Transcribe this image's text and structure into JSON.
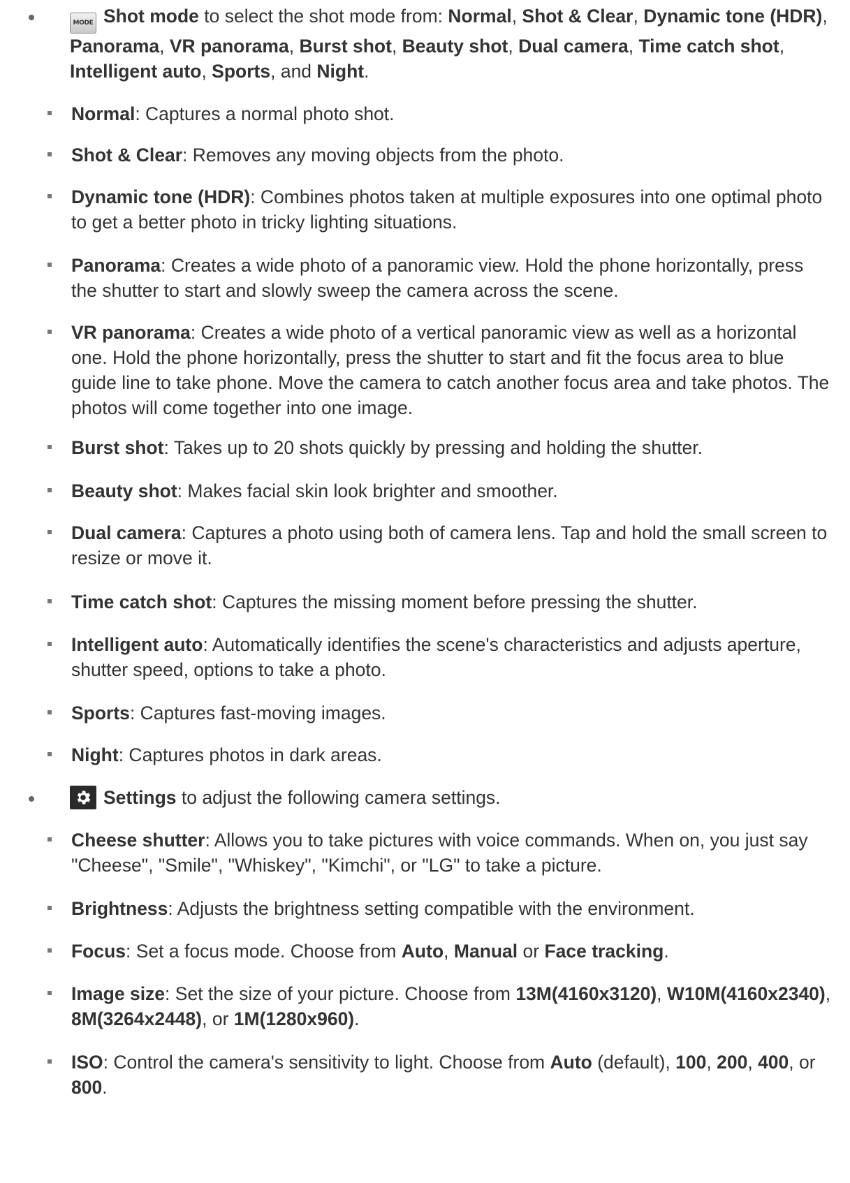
{
  "shot_mode": {
    "icon": "mode-icon",
    "icon_text": "MODE",
    "intro": [
      {
        "t": "Shot mode",
        "b": true
      },
      {
        "t": " to select the shot mode from: "
      },
      {
        "t": "Normal",
        "b": true
      },
      {
        "t": ", "
      },
      {
        "t": "Shot & Clear",
        "b": true
      },
      {
        "t": ", "
      },
      {
        "t": "Dynamic tone (HDR)",
        "b": true
      },
      {
        "t": ", "
      },
      {
        "t": "Panorama",
        "b": true
      },
      {
        "t": ", "
      },
      {
        "t": "VR panorama",
        "b": true
      },
      {
        "t": ", "
      },
      {
        "t": "Burst shot",
        "b": true
      },
      {
        "t": ", "
      },
      {
        "t": "Beauty shot",
        "b": true
      },
      {
        "t": ", "
      },
      {
        "t": "Dual camera",
        "b": true
      },
      {
        "t": ", "
      },
      {
        "t": "Time catch shot",
        "b": true
      },
      {
        "t": ", "
      },
      {
        "t": "Intelligent auto",
        "b": true
      },
      {
        "t": ", "
      },
      {
        "t": "Sports",
        "b": true
      },
      {
        "t": ", and "
      },
      {
        "t": "Night",
        "b": true
      },
      {
        "t": "."
      }
    ],
    "items": [
      [
        {
          "t": "Normal",
          "b": true
        },
        {
          "t": ": Captures a normal photo shot."
        }
      ],
      [
        {
          "t": "Shot & Clear",
          "b": true
        },
        {
          "t": ": Removes any moving objects from the photo."
        }
      ],
      [
        {
          "t": "Dynamic tone (HDR)",
          "b": true
        },
        {
          "t": ": Combines photos taken at multiple exposures into one optimal photo to get a better photo in tricky lighting situations."
        }
      ],
      [
        {
          "t": "Panorama",
          "b": true
        },
        {
          "t": ": Creates a wide photo of a panoramic view. Hold the phone horizontally, press the shutter to start and slowly sweep the camera across the scene."
        }
      ],
      [
        {
          "t": "VR panorama",
          "b": true
        },
        {
          "t": ": Creates a wide photo of a vertical panoramic view as well as a horizontal one. Hold the phone horizontally, press the shutter to start and fit the focus area to blue guide line to take phone. Move the camera to catch another focus area and take photos. The photos will come together into one image."
        }
      ],
      [
        {
          "t": "Burst shot",
          "b": true
        },
        {
          "t": ": Takes up to 20 shots quickly by pressing and holding the shutter."
        }
      ],
      [
        {
          "t": "Beauty shot",
          "b": true
        },
        {
          "t": ": Makes facial skin look brighter and smoother."
        }
      ],
      [
        {
          "t": "Dual camera",
          "b": true
        },
        {
          "t": ": Captures a photo using both of camera lens. Tap and hold the small screen to resize or move it."
        }
      ],
      [
        {
          "t": "Time catch shot",
          "b": true
        },
        {
          "t": ": Captures the missing moment before pressing the shutter."
        }
      ],
      [
        {
          "t": "Intelligent auto",
          "b": true
        },
        {
          "t": ": Automatically identifies the scene's characteristics and adjusts aperture, shutter speed, options to take a photo."
        }
      ],
      [
        {
          "t": "Sports",
          "b": true
        },
        {
          "t": ": Captures fast-moving images."
        }
      ],
      [
        {
          "t": "Night",
          "b": true
        },
        {
          "t": ": Captures photos in dark areas."
        }
      ]
    ]
  },
  "settings": {
    "icon": "gear-icon",
    "intro": [
      {
        "t": "Settings",
        "b": true
      },
      {
        "t": " to adjust the following camera settings."
      }
    ],
    "items": [
      [
        {
          "t": "Cheese shutter",
          "b": true
        },
        {
          "t": ": Allows you to take pictures with voice commands. When on, you just say \"Cheese\", \"Smile\", \"Whiskey\", \"Kimchi\", or \"LG\" to take a picture."
        }
      ],
      [
        {
          "t": "Brightness",
          "b": true
        },
        {
          "t": ": Adjusts the brightness setting compatible with the environment."
        }
      ],
      [
        {
          "t": "Focus",
          "b": true
        },
        {
          "t": ": Set a focus mode. Choose from "
        },
        {
          "t": "Auto",
          "b": true
        },
        {
          "t": ", "
        },
        {
          "t": "Manual",
          "b": true
        },
        {
          "t": " or "
        },
        {
          "t": "Face tracking",
          "b": true
        },
        {
          "t": "."
        }
      ],
      [
        {
          "t": "Image size",
          "b": true
        },
        {
          "t": ": Set the size of your picture. Choose from "
        },
        {
          "t": "13M(4160x3120)",
          "b": true
        },
        {
          "t": ", "
        },
        {
          "t": "W10M(4160x2340)",
          "b": true
        },
        {
          "t": ", "
        },
        {
          "t": "8M(3264x2448)",
          "b": true
        },
        {
          "t": ", or "
        },
        {
          "t": "1M(1280x960)",
          "b": true
        },
        {
          "t": "."
        }
      ],
      [
        {
          "t": "ISO",
          "b": true
        },
        {
          "t": ": Control the camera's sensitivity to light. Choose from "
        },
        {
          "t": "Auto",
          "b": true
        },
        {
          "t": " (default), "
        },
        {
          "t": "100",
          "b": true
        },
        {
          "t": ", "
        },
        {
          "t": "200",
          "b": true
        },
        {
          "t": ", "
        },
        {
          "t": "400",
          "b": true
        },
        {
          "t": ", or "
        },
        {
          "t": "800",
          "b": true
        },
        {
          "t": "."
        }
      ]
    ]
  }
}
